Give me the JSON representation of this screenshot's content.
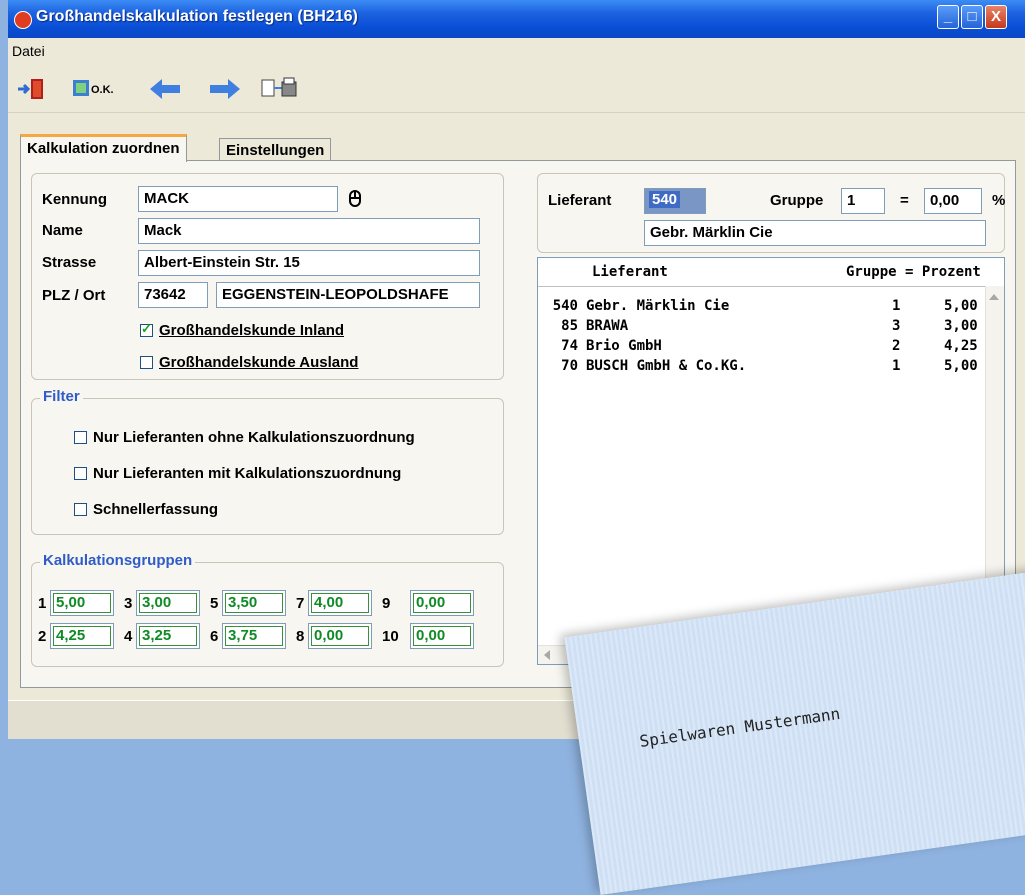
{
  "window": {
    "title": "Großhandelskalkulation festlegen (BH216)",
    "minimize": "_",
    "maximize": "□",
    "close": "X"
  },
  "menu": {
    "datei": "Datei"
  },
  "toolbar": {
    "ok_label": "O.K."
  },
  "tabs": {
    "kalkulation": "Kalkulation zuordnen",
    "einstellungen": "Einstellungen"
  },
  "customer": {
    "kennung_label": "Kennung",
    "kennung": "MACK",
    "name_label": "Name",
    "name": "Mack",
    "strasse_label": "Strasse",
    "strasse": "Albert-Einstein Str. 15",
    "plz_label": "PLZ / Ort",
    "plz": "73642",
    "ort": "EGGENSTEIN-LEOPOLDSHAFE",
    "inland_label": "Großhandelskunde Inland",
    "inland_checked": true,
    "ausland_label": "Großhandelskunde Ausland",
    "ausland_checked": false
  },
  "filter": {
    "legend": "Filter",
    "ohne": "Nur Lieferanten ohne Kalkulationszuordnung",
    "mit": "Nur Lieferanten mit Kalkulationszuordnung",
    "schnell": "Schnellerfassung"
  },
  "kalkulationsgruppen": {
    "legend": "Kalkulationsgruppen",
    "groups": [
      {
        "num": "1",
        "value": "5,00"
      },
      {
        "num": "3",
        "value": "3,00"
      },
      {
        "num": "5",
        "value": "3,50"
      },
      {
        "num": "7",
        "value": "4,00"
      },
      {
        "num": "9",
        "value": "0,00"
      },
      {
        "num": "2",
        "value": "4,25"
      },
      {
        "num": "4",
        "value": "3,25"
      },
      {
        "num": "6",
        "value": "3,75"
      },
      {
        "num": "8",
        "value": "0,00"
      },
      {
        "num": "10",
        "value": "0,00"
      }
    ]
  },
  "lieferant": {
    "label": "Lieferant",
    "nr": "540",
    "gruppe_label": "Gruppe",
    "gruppe": "1",
    "equals": "=",
    "prozent": "0,00",
    "percent_sign": "%",
    "name": "Gebr. Märklin Cie"
  },
  "list": {
    "header_lieferant": "Lieferant",
    "header_gruppe": "Gruppe = Prozent",
    "rows": [
      {
        "nr": "540",
        "name": "Gebr. Märklin  Cie",
        "gruppe": "1",
        "prozent": "5,00"
      },
      {
        "nr": "85",
        "name": "BRAWA",
        "gruppe": "3",
        "prozent": "3,00"
      },
      {
        "nr": "74",
        "name": "Brio GmbH",
        "gruppe": "2",
        "prozent": "4,25"
      },
      {
        "nr": "70",
        "name": "BUSCH GmbH & Co.KG.",
        "gruppe": "1",
        "prozent": "5,00"
      }
    ]
  },
  "paper": {
    "line1": "Spielwaren Mustermann"
  }
}
